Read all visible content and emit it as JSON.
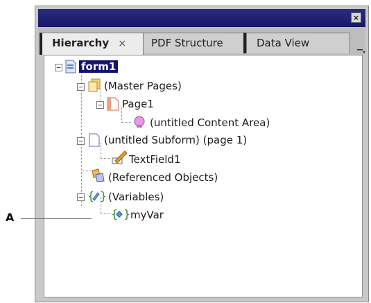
{
  "window": {
    "close_glyph": "×"
  },
  "tabs": [
    {
      "label": "Hierarchy",
      "close": "×",
      "active": true
    },
    {
      "label": "PDF Structure",
      "active": false
    },
    {
      "label": "Data View",
      "active": false
    }
  ],
  "tree": {
    "root": "form1",
    "master_pages": "(Master Pages)",
    "page1": "Page1",
    "content_area": "(untitled Content Area)",
    "subform": "(untitled Subform) (page 1)",
    "textfield": "TextField1",
    "referenced": "(Referenced Objects)",
    "variables": "(Variables)",
    "myvar": "myVar"
  },
  "expanders": {
    "minus": "−"
  },
  "callout": {
    "label": "A"
  },
  "colors": {
    "selection": "#14146e",
    "titlebar": "#17176a"
  }
}
